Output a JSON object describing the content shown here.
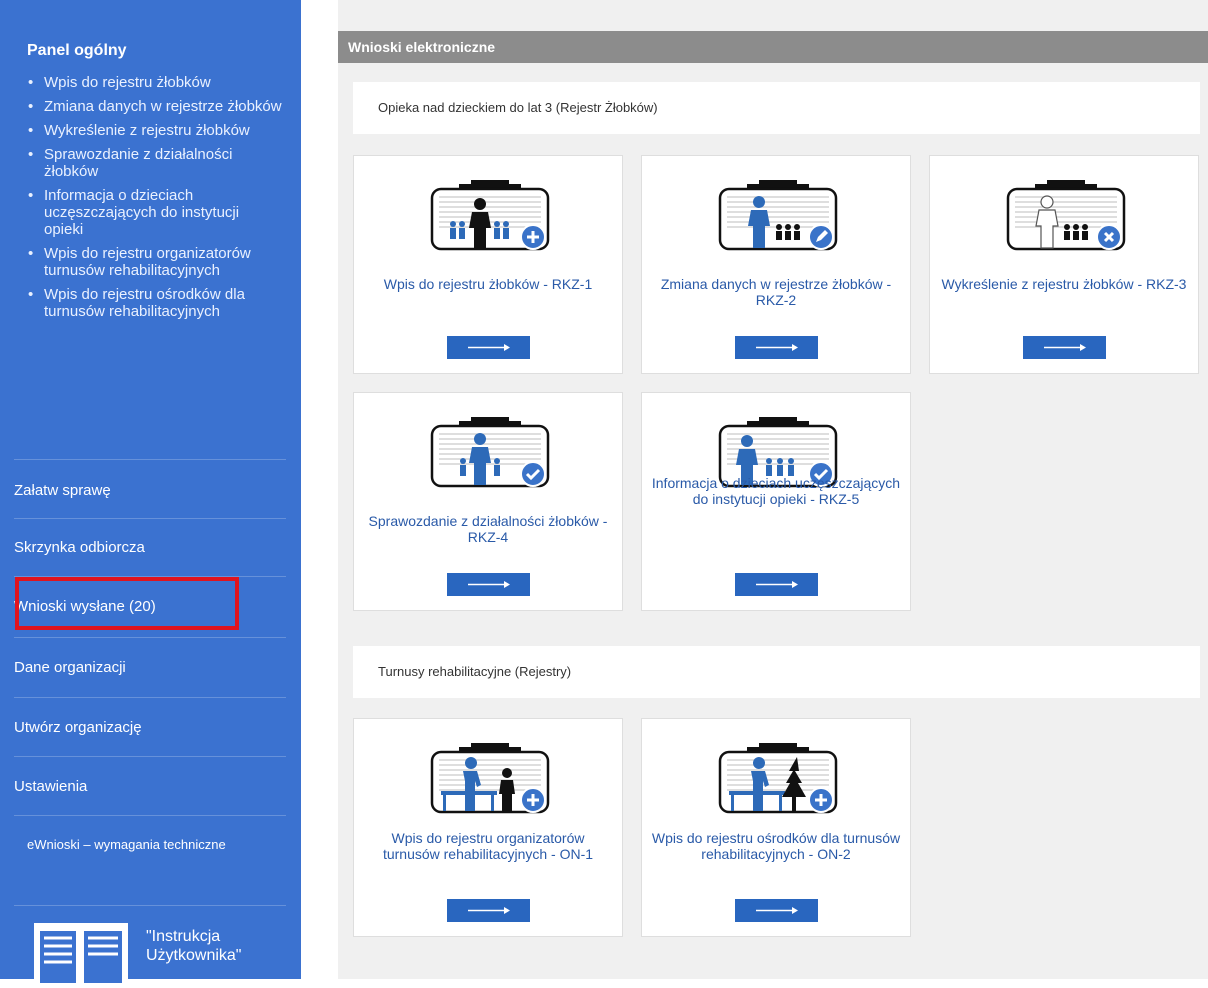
{
  "sidebar": {
    "panel_title": "Panel ogólny",
    "panel_links": [
      "Wpis do rejestru żłobków",
      "Zmiana danych w rejestrze żłobków",
      "Wykreślenie z rejestru żłobków",
      "Sprawozdanie z działalności żłobków",
      "Informacja o dzieciach uczęszczających do instytucji opieki",
      "Wpis do rejestru organizatorów turnusów rehabilitacyjnych",
      "Wpis do rejestru ośrodków dla turnusów rehabilitacyjnych"
    ],
    "nav": [
      "Załatw sprawę",
      "Skrzynka odbiorcza",
      "Wnioski wysłane (20)",
      "Dane organizacji",
      "Utwórz organizację",
      "Ustawienia"
    ],
    "tech_requirements": "eWnioski – wymagania techniczne",
    "manual": "\"Instrukcja Użytkownika\"",
    "highlight_color": "#e0141e"
  },
  "main": {
    "header": "Wnioski elektroniczne",
    "sections": [
      {
        "title": "Opieka nad dzieckiem do lat 3 (Rejestr Żłobków)",
        "cards": [
          {
            "title": "Wpis do rejestru żłobków - RKZ-1",
            "icon": "plus-badge-icon"
          },
          {
            "title": "Zmiana danych w rejestrze żłobków - RKZ-2",
            "icon": "pencil-badge-icon"
          },
          {
            "title": "Wykreślenie z rejestru żłobków - RKZ-3",
            "icon": "x-badge-icon"
          },
          {
            "title": "Sprawozdanie z działalności żłobków - RKZ-4",
            "icon": "check-badge-icon"
          },
          {
            "title": "Informacja o dzieciach uczęszczających do instytucji opieki - RKZ-5",
            "icon": "check-badge-icon"
          }
        ]
      },
      {
        "title": "Turnusy rehabilitacyjne (Rejestry)",
        "cards": [
          {
            "title": "Wpis do rejestru organizatorów turnusów rehabilitacyjnych - ON-1",
            "icon": "plus-badge-icon"
          },
          {
            "title": "Wpis do rejestru ośrodków dla turnusów rehabilitacyjnych - ON-2",
            "icon": "plus-badge-icon"
          }
        ]
      }
    ]
  },
  "colors": {
    "sidebar_bg": "#3b72d0",
    "header_bg": "#8c8c8c",
    "button_bg": "#2966bf",
    "link_color": "#2a5aa8",
    "badge": "#3a73c9"
  }
}
